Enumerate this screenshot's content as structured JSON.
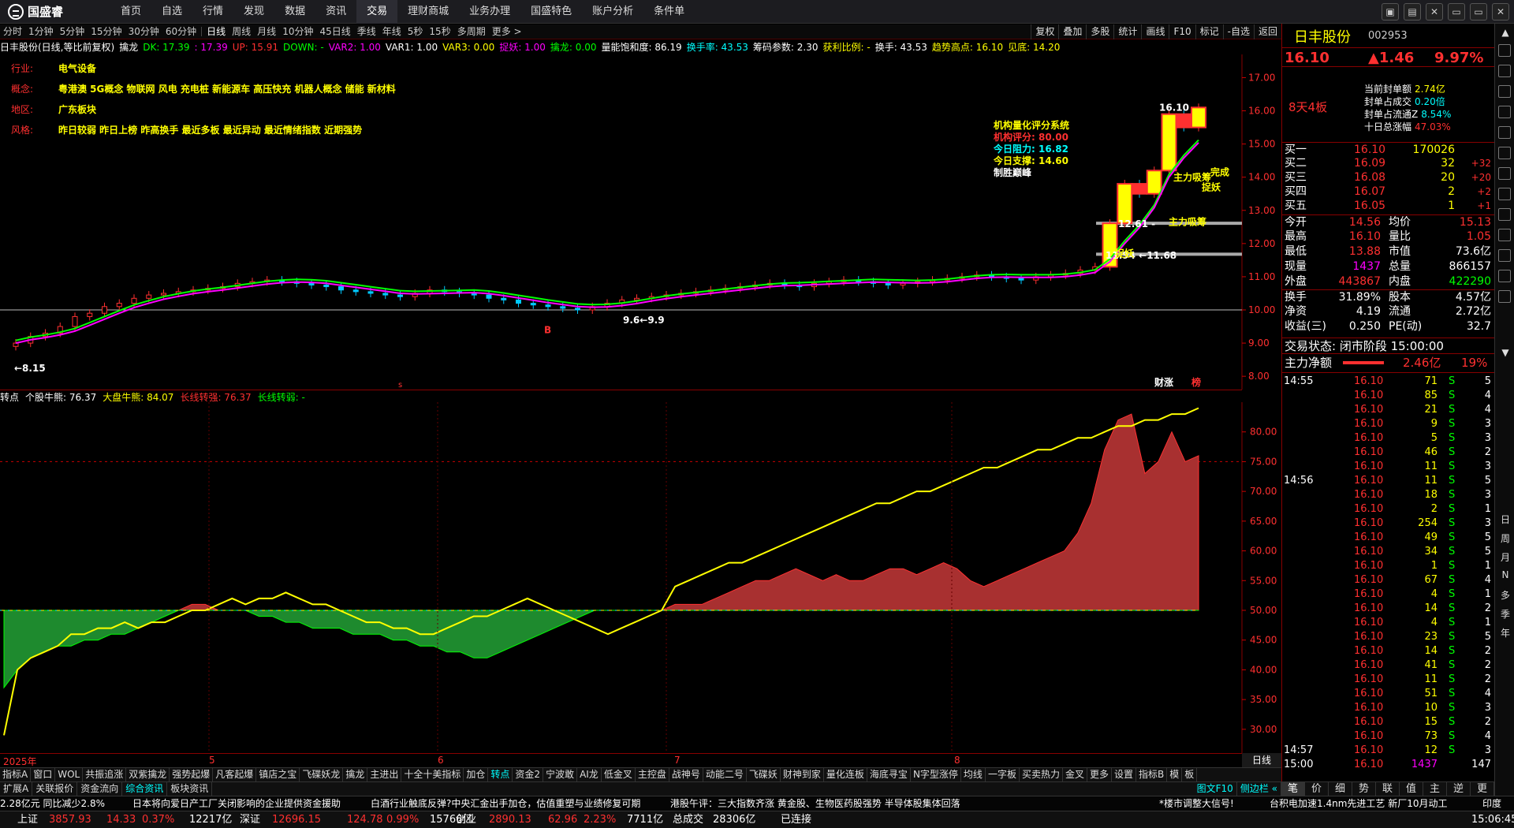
{
  "app": {
    "logo_text": "国盛睿",
    "window_controls": [
      "▣",
      "▤",
      "✕",
      "▭",
      "▭",
      "✕"
    ]
  },
  "topnav": [
    "首页",
    "自选",
    "行情",
    "发现",
    "数据",
    "资讯",
    "交易",
    "理财商城",
    "业务办理",
    "国盛特色",
    "账户分析",
    "条件单"
  ],
  "topnav_active": 6,
  "periods": [
    "分时",
    "1分钟",
    "5分钟",
    "15分钟",
    "30分钟",
    "60分钟",
    "日线",
    "周线",
    "月线",
    "10分钟",
    "45日线",
    "季线",
    "年线",
    "5秒",
    "15秒",
    "多周期",
    "更多 >"
  ],
  "period_active": 6,
  "right_tools": [
    "复权",
    "叠加",
    "多股",
    "统计",
    "画线",
    "F10",
    "标记",
    "-自选",
    "返回"
  ],
  "indicator_line": [
    {
      "t": "日丰股份(日线,等比前复权)",
      "c": "#ffffff"
    },
    {
      "t": "擒龙",
      "c": "#ffffff"
    },
    {
      "t": "DK: 17.39",
      "c": "#00ff00"
    },
    {
      "t": ": 17.39",
      "c": "#ff00ff"
    },
    {
      "t": "UP: 15.91",
      "c": "#ff3030"
    },
    {
      "t": "DOWN: -",
      "c": "#00ff00"
    },
    {
      "t": "VAR2: 1.00",
      "c": "#ff00ff"
    },
    {
      "t": "VAR1: 1.00",
      "c": "#ffffff"
    },
    {
      "t": "VAR3: 0.00",
      "c": "#ffff00"
    },
    {
      "t": "捉妖: 1.00",
      "c": "#ff00ff"
    },
    {
      "t": "擒龙: 0.00",
      "c": "#00ff00"
    },
    {
      "t": "量能饱和度: 86.19",
      "c": "#ffffff"
    },
    {
      "t": "换手率: 43.53",
      "c": "#00ffff"
    },
    {
      "t": "筹码参数: 2.30",
      "c": "#ffffff"
    },
    {
      "t": "获利比例: -",
      "c": "#ffff00"
    },
    {
      "t": "换手: 43.53",
      "c": "#ffffff"
    },
    {
      "t": "趋势高点: 16.10",
      "c": "#ffff00"
    },
    {
      "t": "见底: 14.20",
      "c": "#ffff00"
    }
  ],
  "info": [
    {
      "label": "行业:",
      "value": "电气设备"
    },
    {
      "label": "概念:",
      "value": "粤港澳 5G概念 物联网 风电 充电桩 新能源车 高压快充 机器人概念 储能 新材料"
    },
    {
      "label": "地区:",
      "value": "广东板块"
    },
    {
      "label": "风格:",
      "value": "昨日较弱 昨日上榜 昨高换手 最近多板 最近异动 最近情绪指数 近期强势"
    }
  ],
  "jigou": [
    {
      "t": "机构量化评分系统",
      "c": "#ffff00"
    },
    {
      "t": "机构评分: 80.00",
      "c": "#ff3030"
    },
    {
      "t": "今日阻力: 16.82",
      "c": "#00ffff"
    },
    {
      "t": "今日支撑: 14.60",
      "c": "#ffff00"
    },
    {
      "t": "制胜巅峰",
      "c": "#ffffff"
    }
  ],
  "price_axis": [
    "17.00",
    "16.00",
    "15.00",
    "14.00",
    "13.00",
    "12.00",
    "11.00",
    "10.00",
    "9.00",
    "8.00"
  ],
  "main_annotations": [
    {
      "t": "←8.15",
      "c": "#ffffff"
    },
    {
      "t": "16.10",
      "c": "#ffffff"
    },
    {
      "t": "12.61 -",
      "c": "#ffffff"
    },
    {
      "t": "11.94 ←11.68",
      "c": "#ffffff"
    },
    {
      "t": "9.6←9.9",
      "c": "#ffffff"
    },
    {
      "t": "主力吸筹",
      "c": "#ffff00"
    },
    {
      "t": "完成",
      "c": "#ffff00"
    },
    {
      "t": "捉妖",
      "c": "#ffff00"
    },
    {
      "t": "主力吸筹",
      "c": "#ffff00"
    },
    {
      "t": "捉妖",
      "c": "#ffff00"
    },
    {
      "t": "财涨",
      "c": "#ffffff"
    },
    {
      "t": "榜",
      "c": "#ff3030"
    },
    {
      "t": "B",
      "c": "#ff3030"
    }
  ],
  "sub_header": [
    {
      "t": "转点",
      "c": "#ffffff"
    },
    {
      "t": "个股牛熊: 76.37",
      "c": "#ffffff"
    },
    {
      "t": "大盘牛熊: 84.07",
      "c": "#ffff00"
    },
    {
      "t": "长线转强: 76.37",
      "c": "#ff3030"
    },
    {
      "t": "长线转弱: -",
      "c": "#00ff00"
    }
  ],
  "sub_axis": [
    "80.00",
    "75.00",
    "70.00",
    "65.00",
    "60.00",
    "55.00",
    "50.00",
    "45.00",
    "40.00",
    "35.00",
    "30.00"
  ],
  "date_labels": [
    "2025年",
    "5",
    "6",
    "7",
    "8"
  ],
  "kline_label": "日线",
  "chart_data": {
    "type": "candlestick",
    "y_range": [
      7.6,
      17.7
    ],
    "closes": [
      9.0,
      9.2,
      9.3,
      9.5,
      9.8,
      9.9,
      10.1,
      10.2,
      10.35,
      10.45,
      10.5,
      10.55,
      10.6,
      10.65,
      10.7,
      10.8,
      10.85,
      10.9,
      10.85,
      10.8,
      10.75,
      10.7,
      10.6,
      10.55,
      10.5,
      10.45,
      10.4,
      10.5,
      10.6,
      10.55,
      10.5,
      10.45,
      10.35,
      10.3,
      10.2,
      10.15,
      10.1,
      10.05,
      10.0,
      10.1,
      10.2,
      10.3,
      10.35,
      10.4,
      10.45,
      10.5,
      10.55,
      10.6,
      10.65,
      10.7,
      10.75,
      10.8,
      10.75,
      10.7,
      10.8,
      10.85,
      10.9,
      10.85,
      10.8,
      10.75,
      10.8,
      10.85,
      10.9,
      10.95,
      11.0,
      11.05,
      11.0,
      10.95,
      10.9,
      11.0,
      11.05,
      11.1,
      11.2,
      11.3,
      12.61,
      13.8,
      13.5,
      14.2,
      15.9,
      15.5,
      16.1
    ],
    "sub_chart": {
      "y_range": [
        26,
        85
      ],
      "yellow": [
        29,
        40,
        42,
        43,
        44,
        46,
        46,
        47,
        47,
        48,
        47,
        48,
        48,
        49,
        50,
        50,
        51,
        52,
        51,
        52,
        52,
        53,
        52,
        51,
        51,
        50,
        49,
        48,
        48,
        47,
        47,
        46,
        46,
        47,
        48,
        49,
        49,
        50,
        51,
        52,
        51,
        50,
        49,
        48,
        47,
        46,
        47,
        48,
        49,
        50,
        54,
        55,
        56,
        57,
        58,
        58,
        59,
        60,
        61,
        62,
        63,
        64,
        65,
        66,
        67,
        68,
        68,
        69,
        70,
        70,
        71,
        72,
        73,
        74,
        74,
        75,
        76,
        77,
        77,
        78,
        79,
        79,
        80,
        81,
        81,
        82,
        82,
        83,
        83,
        84
      ],
      "area": [
        37,
        40,
        42,
        43,
        44,
        44,
        45,
        45,
        46,
        46,
        47,
        48,
        49,
        50,
        51,
        51,
        50,
        50,
        50,
        49,
        49,
        48,
        48,
        47,
        47,
        47,
        46,
        46,
        46,
        45,
        45,
        44,
        44,
        43,
        43,
        42,
        42,
        43,
        44,
        45,
        46,
        47,
        48,
        49,
        50,
        50,
        50,
        50,
        50,
        50,
        51,
        51,
        51,
        52,
        53,
        54,
        55,
        55,
        56,
        57,
        56,
        55,
        56,
        55,
        55,
        56,
        57,
        57,
        56,
        57,
        58,
        57,
        55,
        54,
        55,
        56,
        57,
        58,
        59,
        60,
        63,
        68,
        77,
        82,
        83,
        73,
        75,
        80,
        75,
        76
      ]
    }
  },
  "rpanel": {
    "name": "日丰股份",
    "code": "002953",
    "price": "16.10",
    "change": "▲1.46",
    "pct": "9.97%",
    "tag": "8天4板",
    "seal": [
      {
        "l": "当前封单额",
        "v": "2.74亿",
        "c": "#ffff00"
      },
      {
        "l": "封单占成交",
        "v": "0.20倍",
        "c": "#00ffff"
      },
      {
        "l": "封单占流通Z",
        "v": "8.54%",
        "c": "#00ffff"
      },
      {
        "l": "十日总涨幅",
        "v": "47.03%",
        "c": "#ff3030"
      }
    ],
    "buys": [
      {
        "l": "买一",
        "p": "16.10",
        "v": "170026",
        "d": ""
      },
      {
        "l": "买二",
        "p": "16.09",
        "v": "32",
        "d": "+32"
      },
      {
        "l": "买三",
        "p": "16.08",
        "v": "20",
        "d": "+20"
      },
      {
        "l": "买四",
        "p": "16.07",
        "v": "2",
        "d": "+2"
      },
      {
        "l": "买五",
        "p": "16.05",
        "v": "1",
        "d": "+1"
      }
    ],
    "stats": [
      {
        "l1": "今开",
        "v1": "14.56",
        "c1": "#ff3030",
        "l2": "均价",
        "v2": "15.13",
        "c2": "#ff3030"
      },
      {
        "l1": "最高",
        "v1": "16.10",
        "c1": "#ff3030",
        "l2": "量比",
        "v2": "1.05",
        "c2": "#ff3030"
      },
      {
        "l1": "最低",
        "v1": "13.88",
        "c1": "#ff3030",
        "l2": "市值",
        "v2": "73.6亿",
        "c2": "#ffffff"
      },
      {
        "l1": "现量",
        "v1": "1437",
        "c1": "#ff00ff",
        "l2": "总量",
        "v2": "866157",
        "c2": "#ffffff"
      },
      {
        "l1": "外盘",
        "v1": "443867",
        "c1": "#ff3030",
        "l2": "内盘",
        "v2": "422290",
        "c2": "#00ff00"
      },
      {
        "l1": "换手",
        "v1": "31.89%",
        "c1": "#ffffff",
        "l2": "股本",
        "v2": "4.57亿",
        "c2": "#ffffff"
      },
      {
        "l1": "净资",
        "v1": "4.19",
        "c1": "#ffffff",
        "l2": "流通",
        "v2": "2.72亿",
        "c2": "#ffffff"
      },
      {
        "l1": "收益(三)",
        "v1": "0.250",
        "c1": "#ffffff",
        "l2": "PE(动)",
        "v2": "32.7",
        "c2": "#ffffff"
      }
    ],
    "state": "交易状态: 闭市阶段 15:00:00",
    "mainnet_label": "主力净额",
    "mainnet_val": "2.46亿",
    "mainnet_pct": "19%",
    "ticks": [
      {
        "t": "14:55",
        "p": "16.10",
        "v": "71",
        "s": "S",
        "n": "5"
      },
      {
        "t": "",
        "p": "16.10",
        "v": "85",
        "s": "S",
        "n": "4"
      },
      {
        "t": "",
        "p": "16.10",
        "v": "21",
        "s": "S",
        "n": "4"
      },
      {
        "t": "",
        "p": "16.10",
        "v": "9",
        "s": "S",
        "n": "3"
      },
      {
        "t": "",
        "p": "16.10",
        "v": "5",
        "s": "S",
        "n": "3"
      },
      {
        "t": "",
        "p": "16.10",
        "v": "46",
        "s": "S",
        "n": "2"
      },
      {
        "t": "",
        "p": "16.10",
        "v": "11",
        "s": "S",
        "n": "3"
      },
      {
        "t": "14:56",
        "p": "16.10",
        "v": "11",
        "s": "S",
        "n": "5"
      },
      {
        "t": "",
        "p": "16.10",
        "v": "18",
        "s": "S",
        "n": "3"
      },
      {
        "t": "",
        "p": "16.10",
        "v": "2",
        "s": "S",
        "n": "1"
      },
      {
        "t": "",
        "p": "16.10",
        "v": "254",
        "s": "S",
        "n": "3"
      },
      {
        "t": "",
        "p": "16.10",
        "v": "49",
        "s": "S",
        "n": "5"
      },
      {
        "t": "",
        "p": "16.10",
        "v": "34",
        "s": "S",
        "n": "5"
      },
      {
        "t": "",
        "p": "16.10",
        "v": "1",
        "s": "S",
        "n": "1"
      },
      {
        "t": "",
        "p": "16.10",
        "v": "67",
        "s": "S",
        "n": "4"
      },
      {
        "t": "",
        "p": "16.10",
        "v": "4",
        "s": "S",
        "n": "1"
      },
      {
        "t": "",
        "p": "16.10",
        "v": "14",
        "s": "S",
        "n": "2"
      },
      {
        "t": "",
        "p": "16.10",
        "v": "4",
        "s": "S",
        "n": "1"
      },
      {
        "t": "",
        "p": "16.10",
        "v": "23",
        "s": "S",
        "n": "5"
      },
      {
        "t": "",
        "p": "16.10",
        "v": "14",
        "s": "S",
        "n": "2"
      },
      {
        "t": "",
        "p": "16.10",
        "v": "41",
        "s": "S",
        "n": "2"
      },
      {
        "t": "",
        "p": "16.10",
        "v": "11",
        "s": "S",
        "n": "2"
      },
      {
        "t": "",
        "p": "16.10",
        "v": "51",
        "s": "S",
        "n": "4"
      },
      {
        "t": "",
        "p": "16.10",
        "v": "10",
        "s": "S",
        "n": "3"
      },
      {
        "t": "",
        "p": "16.10",
        "v": "15",
        "s": "S",
        "n": "2"
      },
      {
        "t": "",
        "p": "16.10",
        "v": "73",
        "s": "S",
        "n": "4"
      },
      {
        "t": "14:57",
        "p": "16.10",
        "v": "12",
        "s": "S",
        "n": "3"
      },
      {
        "t": "15:00",
        "p": "16.10",
        "v": "1437",
        "s": "",
        "n": "147"
      }
    ],
    "bottom_tabs": [
      "笔",
      "价",
      "细",
      "势",
      "联",
      "值",
      "主",
      "逆",
      "更"
    ]
  },
  "right_side_chars": [
    "日",
    "周",
    "月",
    "N",
    "多",
    "季",
    "年"
  ],
  "tabs1": [
    "指标A",
    "窗口",
    "WOL",
    "共振追涨",
    "双紫擒龙",
    "强势起爆",
    "凡客起爆",
    "镇店之宝",
    "飞碟妖龙",
    "擒龙",
    "主进出",
    "十全十美指标",
    "加仓",
    "转点",
    "资金2",
    "宁波敢",
    "AI龙",
    "低金叉",
    "主控盘",
    "战神号",
    "动能二号",
    "飞碟妖",
    "财神到家",
    "量化连板",
    "海底寻宝",
    "N字型涨停",
    "均线",
    "一字板",
    "买卖热力",
    "金叉",
    "更多",
    "设置",
    "指标B",
    "模",
    "板"
  ],
  "tabs1_hl": 13,
  "tabs2": [
    "扩展A",
    "关联报价",
    "资金流向",
    "综合资讯",
    "板块资讯"
  ],
  "tabs2_hl": 3,
  "tabs2_right": [
    "图文F10",
    "侧边栏 «"
  ],
  "news": [
    "2.28亿元  同比减少2.8%",
    "日本将向爱日产工厂关闭影响的企业提供资金援助",
    "白酒行业触底反弹?中央汇金出手加仓，估值重塑与业绩修复可期",
    "港股午评：三大指数齐涨 黄金股、生物医药股强势 半导体股集体回落",
    "*楼市调整大信号!",
    "台积电加速1.4nm先进工艺 新厂10月动工",
    "印度"
  ],
  "status": [
    {
      "t": "上证",
      "c": "#ffffff"
    },
    {
      "t": "3857.93",
      "c": "#ff3030"
    },
    {
      "t": "14.33",
      "c": "#ff3030"
    },
    {
      "t": "0.37%",
      "c": "#ff3030"
    },
    {
      "t": "12217亿",
      "c": "#ffffff"
    },
    {
      "t": "深证",
      "c": "#ffffff"
    },
    {
      "t": "12696.15",
      "c": "#ff3030"
    },
    {
      "t": "124.78",
      "c": "#ff3030"
    },
    {
      "t": "0.99%",
      "c": "#ff3030"
    },
    {
      "t": "15766亿",
      "c": "#ffffff"
    },
    {
      "t": "创业",
      "c": "#ffffff"
    },
    {
      "t": "2890.13",
      "c": "#ff3030"
    },
    {
      "t": "62.96",
      "c": "#ff3030"
    },
    {
      "t": "2.23%",
      "c": "#ff3030"
    },
    {
      "t": "7711亿",
      "c": "#ffffff"
    },
    {
      "t": "总成交",
      "c": "#ffffff"
    },
    {
      "t": "28306亿",
      "c": "#ffffff"
    },
    {
      "t": "已连接",
      "c": "#ffffff"
    },
    {
      "t": "15:06:45",
      "c": "#ffffff"
    }
  ]
}
